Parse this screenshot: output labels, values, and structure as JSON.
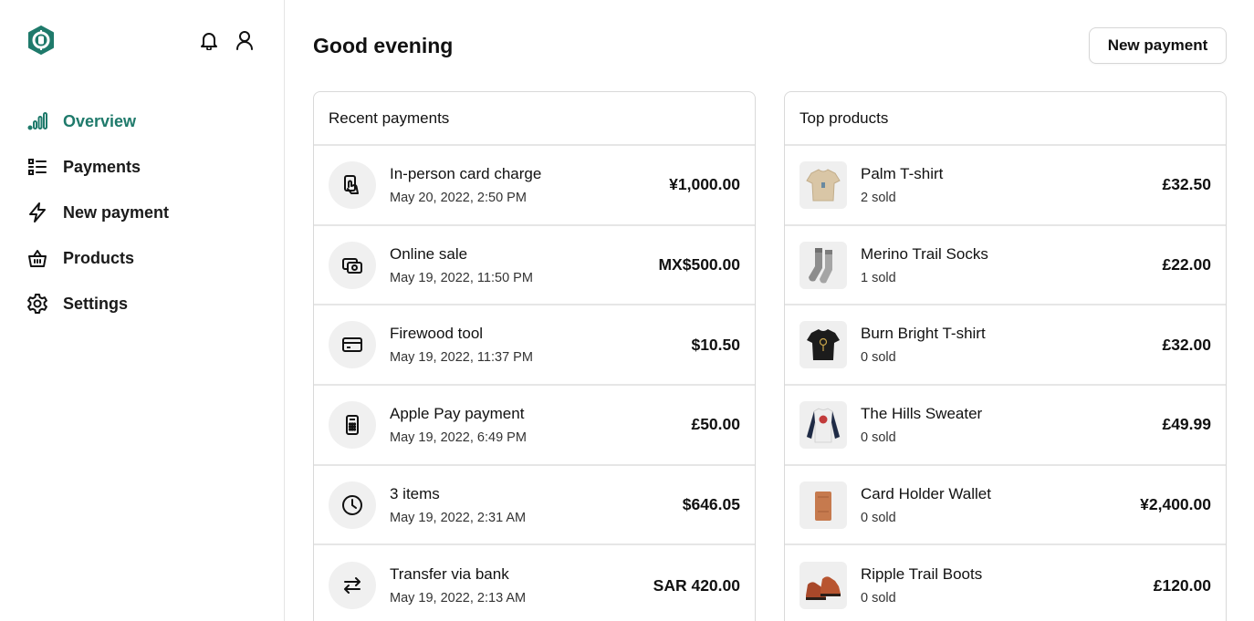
{
  "sidebar": {
    "nav": [
      {
        "label": "Overview",
        "icon": "chart-bars-icon",
        "active": true
      },
      {
        "label": "Payments",
        "icon": "list-icon"
      },
      {
        "label": "New payment",
        "icon": "lightning-icon"
      },
      {
        "label": "Products",
        "icon": "basket-icon"
      },
      {
        "label": "Settings",
        "icon": "gear-icon"
      }
    ]
  },
  "header": {
    "greeting": "Good evening",
    "new_payment_label": "New payment"
  },
  "recent_payments": {
    "title": "Recent payments",
    "items": [
      {
        "title": "In-person card charge",
        "date": "May 20, 2022, 2:50 PM",
        "amount": "¥1,000.00",
        "icon": "card-tap-icon"
      },
      {
        "title": "Online sale",
        "date": "May 19, 2022, 11:50 PM",
        "amount": "MX$500.00",
        "icon": "online-sale-icon"
      },
      {
        "title": "Firewood tool",
        "date": "May 19, 2022, 11:37 PM",
        "amount": "$10.50",
        "icon": "credit-card-icon"
      },
      {
        "title": "Apple Pay payment",
        "date": "May 19, 2022, 6:49 PM",
        "amount": "£50.00",
        "icon": "phone-pay-icon"
      },
      {
        "title": "3 items",
        "date": "May 19, 2022, 2:31 AM",
        "amount": "$646.05",
        "icon": "clock-icon"
      },
      {
        "title": "Transfer via bank",
        "date": "May 19, 2022, 2:13 AM",
        "amount": "SAR 420.00",
        "icon": "transfer-arrows-icon"
      }
    ]
  },
  "top_products": {
    "title": "Top products",
    "items": [
      {
        "name": "Palm T-shirt",
        "sold": "2 sold",
        "price": "£32.50",
        "image": "tan-tshirt-image"
      },
      {
        "name": "Merino Trail Socks",
        "sold": "1 sold",
        "price": "£22.00",
        "image": "socks-image"
      },
      {
        "name": "Burn Bright T-shirt",
        "sold": "0 sold",
        "price": "£32.00",
        "image": "black-tshirt-image"
      },
      {
        "name": "The Hills Sweater",
        "sold": "0 sold",
        "price": "£49.99",
        "image": "sweater-image"
      },
      {
        "name": "Card Holder Wallet",
        "sold": "0 sold",
        "price": "¥2,400.00",
        "image": "wallet-image"
      },
      {
        "name": "Ripple Trail Boots",
        "sold": "0 sold",
        "price": "£120.00",
        "image": "boots-image"
      }
    ]
  },
  "colors": {
    "accent": "#1f7a6b",
    "border": "#e6e6e6",
    "icon_bg": "#f0f0f0"
  }
}
